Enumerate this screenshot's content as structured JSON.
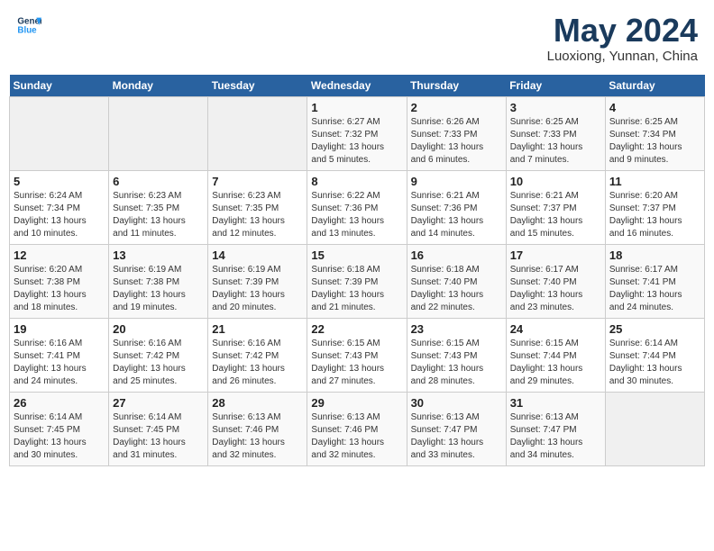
{
  "header": {
    "logo_line1": "General",
    "logo_line2": "Blue",
    "main_title": "May 2024",
    "subtitle": "Luoxiong, Yunnan, China"
  },
  "days_of_week": [
    "Sunday",
    "Monday",
    "Tuesday",
    "Wednesday",
    "Thursday",
    "Friday",
    "Saturday"
  ],
  "weeks": [
    [
      {
        "day": "",
        "sunrise": "",
        "sunset": "",
        "daylight": ""
      },
      {
        "day": "",
        "sunrise": "",
        "sunset": "",
        "daylight": ""
      },
      {
        "day": "",
        "sunrise": "",
        "sunset": "",
        "daylight": ""
      },
      {
        "day": "1",
        "sunrise": "Sunrise: 6:27 AM",
        "sunset": "Sunset: 7:32 PM",
        "daylight": "Daylight: 13 hours and 5 minutes."
      },
      {
        "day": "2",
        "sunrise": "Sunrise: 6:26 AM",
        "sunset": "Sunset: 7:33 PM",
        "daylight": "Daylight: 13 hours and 6 minutes."
      },
      {
        "day": "3",
        "sunrise": "Sunrise: 6:25 AM",
        "sunset": "Sunset: 7:33 PM",
        "daylight": "Daylight: 13 hours and 7 minutes."
      },
      {
        "day": "4",
        "sunrise": "Sunrise: 6:25 AM",
        "sunset": "Sunset: 7:34 PM",
        "daylight": "Daylight: 13 hours and 9 minutes."
      }
    ],
    [
      {
        "day": "5",
        "sunrise": "Sunrise: 6:24 AM",
        "sunset": "Sunset: 7:34 PM",
        "daylight": "Daylight: 13 hours and 10 minutes."
      },
      {
        "day": "6",
        "sunrise": "Sunrise: 6:23 AM",
        "sunset": "Sunset: 7:35 PM",
        "daylight": "Daylight: 13 hours and 11 minutes."
      },
      {
        "day": "7",
        "sunrise": "Sunrise: 6:23 AM",
        "sunset": "Sunset: 7:35 PM",
        "daylight": "Daylight: 13 hours and 12 minutes."
      },
      {
        "day": "8",
        "sunrise": "Sunrise: 6:22 AM",
        "sunset": "Sunset: 7:36 PM",
        "daylight": "Daylight: 13 hours and 13 minutes."
      },
      {
        "day": "9",
        "sunrise": "Sunrise: 6:21 AM",
        "sunset": "Sunset: 7:36 PM",
        "daylight": "Daylight: 13 hours and 14 minutes."
      },
      {
        "day": "10",
        "sunrise": "Sunrise: 6:21 AM",
        "sunset": "Sunset: 7:37 PM",
        "daylight": "Daylight: 13 hours and 15 minutes."
      },
      {
        "day": "11",
        "sunrise": "Sunrise: 6:20 AM",
        "sunset": "Sunset: 7:37 PM",
        "daylight": "Daylight: 13 hours and 16 minutes."
      }
    ],
    [
      {
        "day": "12",
        "sunrise": "Sunrise: 6:20 AM",
        "sunset": "Sunset: 7:38 PM",
        "daylight": "Daylight: 13 hours and 18 minutes."
      },
      {
        "day": "13",
        "sunrise": "Sunrise: 6:19 AM",
        "sunset": "Sunset: 7:38 PM",
        "daylight": "Daylight: 13 hours and 19 minutes."
      },
      {
        "day": "14",
        "sunrise": "Sunrise: 6:19 AM",
        "sunset": "Sunset: 7:39 PM",
        "daylight": "Daylight: 13 hours and 20 minutes."
      },
      {
        "day": "15",
        "sunrise": "Sunrise: 6:18 AM",
        "sunset": "Sunset: 7:39 PM",
        "daylight": "Daylight: 13 hours and 21 minutes."
      },
      {
        "day": "16",
        "sunrise": "Sunrise: 6:18 AM",
        "sunset": "Sunset: 7:40 PM",
        "daylight": "Daylight: 13 hours and 22 minutes."
      },
      {
        "day": "17",
        "sunrise": "Sunrise: 6:17 AM",
        "sunset": "Sunset: 7:40 PM",
        "daylight": "Daylight: 13 hours and 23 minutes."
      },
      {
        "day": "18",
        "sunrise": "Sunrise: 6:17 AM",
        "sunset": "Sunset: 7:41 PM",
        "daylight": "Daylight: 13 hours and 24 minutes."
      }
    ],
    [
      {
        "day": "19",
        "sunrise": "Sunrise: 6:16 AM",
        "sunset": "Sunset: 7:41 PM",
        "daylight": "Daylight: 13 hours and 24 minutes."
      },
      {
        "day": "20",
        "sunrise": "Sunrise: 6:16 AM",
        "sunset": "Sunset: 7:42 PM",
        "daylight": "Daylight: 13 hours and 25 minutes."
      },
      {
        "day": "21",
        "sunrise": "Sunrise: 6:16 AM",
        "sunset": "Sunset: 7:42 PM",
        "daylight": "Daylight: 13 hours and 26 minutes."
      },
      {
        "day": "22",
        "sunrise": "Sunrise: 6:15 AM",
        "sunset": "Sunset: 7:43 PM",
        "daylight": "Daylight: 13 hours and 27 minutes."
      },
      {
        "day": "23",
        "sunrise": "Sunrise: 6:15 AM",
        "sunset": "Sunset: 7:43 PM",
        "daylight": "Daylight: 13 hours and 28 minutes."
      },
      {
        "day": "24",
        "sunrise": "Sunrise: 6:15 AM",
        "sunset": "Sunset: 7:44 PM",
        "daylight": "Daylight: 13 hours and 29 minutes."
      },
      {
        "day": "25",
        "sunrise": "Sunrise: 6:14 AM",
        "sunset": "Sunset: 7:44 PM",
        "daylight": "Daylight: 13 hours and 30 minutes."
      }
    ],
    [
      {
        "day": "26",
        "sunrise": "Sunrise: 6:14 AM",
        "sunset": "Sunset: 7:45 PM",
        "daylight": "Daylight: 13 hours and 30 minutes."
      },
      {
        "day": "27",
        "sunrise": "Sunrise: 6:14 AM",
        "sunset": "Sunset: 7:45 PM",
        "daylight": "Daylight: 13 hours and 31 minutes."
      },
      {
        "day": "28",
        "sunrise": "Sunrise: 6:13 AM",
        "sunset": "Sunset: 7:46 PM",
        "daylight": "Daylight: 13 hours and 32 minutes."
      },
      {
        "day": "29",
        "sunrise": "Sunrise: 6:13 AM",
        "sunset": "Sunset: 7:46 PM",
        "daylight": "Daylight: 13 hours and 32 minutes."
      },
      {
        "day": "30",
        "sunrise": "Sunrise: 6:13 AM",
        "sunset": "Sunset: 7:47 PM",
        "daylight": "Daylight: 13 hours and 33 minutes."
      },
      {
        "day": "31",
        "sunrise": "Sunrise: 6:13 AM",
        "sunset": "Sunset: 7:47 PM",
        "daylight": "Daylight: 13 hours and 34 minutes."
      },
      {
        "day": "",
        "sunrise": "",
        "sunset": "",
        "daylight": ""
      }
    ]
  ]
}
